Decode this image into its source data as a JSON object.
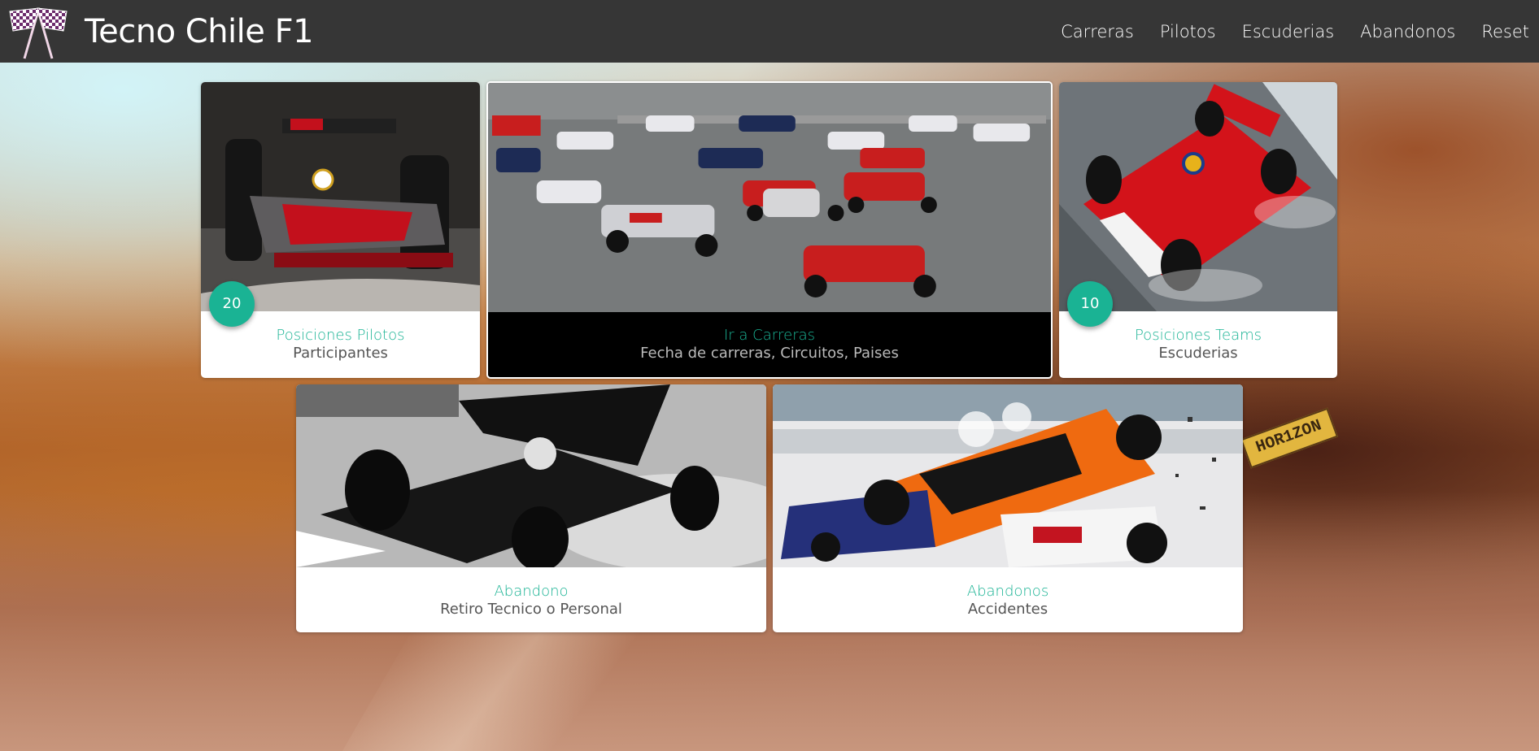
{
  "brand": {
    "title": "Tecno Chile F1",
    "logo_icon": "checkered-flags-icon"
  },
  "nav": {
    "items": [
      "Carreras",
      "Pilotos",
      "Escuderias",
      "Abandonos",
      "Reset"
    ]
  },
  "cards": {
    "pilotos": {
      "badge": "20",
      "title": "Posiciones Pilotos",
      "subtitle": "Participantes",
      "image": "mclaren-f1-car"
    },
    "carreras": {
      "title": "Ir a Carreras",
      "subtitle": "Fecha de carreras, Circuitos, Paises",
      "image": "race-start-grid"
    },
    "teams": {
      "badge": "10",
      "title": "Posiciones Teams",
      "subtitle": "Escuderias",
      "image": "ferrari-rain"
    },
    "abandono": {
      "title": "Abandono",
      "subtitle": "Retiro Tecnico o Personal",
      "image": "black-f1-car-smoke"
    },
    "abandonos": {
      "title": "Abandonos",
      "subtitle": "Accidentes",
      "image": "f1-crash"
    }
  },
  "background": {
    "plate_text": "HOR1ZON"
  },
  "colors": {
    "accent": "#1ab394",
    "navbar": "#363636"
  }
}
